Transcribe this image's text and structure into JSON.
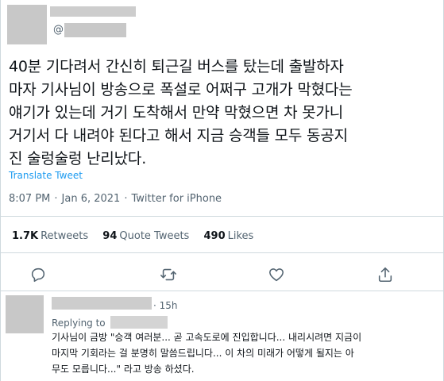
{
  "tweet": {
    "handle_prefix": "@",
    "text_lines": [
      "40분 기다려서 간신히 퇴근길 버스를 탔는데 출발하자",
      "마자 기사님이 방송으로 폭설로 어쩌구 고개가 막혔다는",
      "얘기가 있는데 거기 도착해서 만약 막혔으면 차 못가니",
      "거기서 다 내려야 된다고 해서 지금 승객들 모두 동공지",
      "진 술렁술렁 난리났다."
    ],
    "translate_label": "Translate Tweet",
    "time": "8:07 PM",
    "date": "Jan 6, 2021",
    "source": "Twitter for iPhone",
    "separator": "·"
  },
  "stats": {
    "retweets_count": "1.7K",
    "retweets_label": "Retweets",
    "quote_count": "94",
    "quote_label": "Quote Tweets",
    "likes_count": "490",
    "likes_label": "Likes"
  },
  "actions": {
    "icons": [
      "reply-icon",
      "retweet-icon",
      "like-icon",
      "share-icon"
    ]
  },
  "reply": {
    "time": "· 15h",
    "replying_label": "Replying to",
    "text_lines": [
      "기사님이 금방 \"승객 여러분... 곧 고속도로에 진입합니다... 내리시려면 지금이",
      "마지막 기회라는 걸 분명히 말씀드립니다... 이 차의 미래가 어떻게 될지는 아",
      "무도 모릅니다...\" 라고 방송 하셨다."
    ]
  },
  "colors": {
    "link": "#1d9bf0",
    "secondary_text": "#536471",
    "border": "#cfd9de"
  }
}
